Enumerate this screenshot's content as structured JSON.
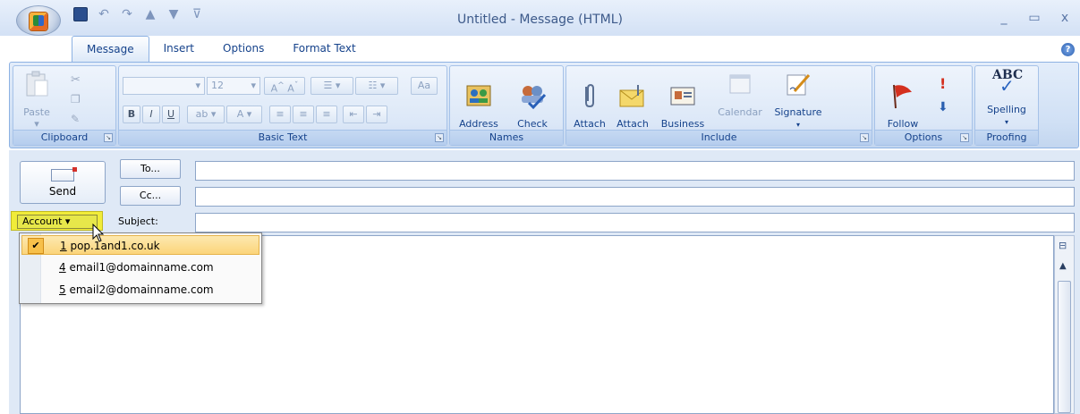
{
  "window": {
    "title": "Untitled - Message (HTML)",
    "minimize": "_",
    "maximize": "▭",
    "close": "x"
  },
  "tabs": [
    "Message",
    "Insert",
    "Options",
    "Format Text"
  ],
  "ribbon": {
    "clipboard": {
      "label": "Clipboard",
      "paste": "Paste"
    },
    "basic_text": {
      "label": "Basic Text",
      "font_size": "12",
      "bold": "B",
      "italic": "I",
      "underline": "U"
    },
    "names": {
      "label": "Names",
      "address_book": "Address\nBook",
      "check_names": "Check\nNames"
    },
    "include": {
      "label": "Include",
      "attach_file": "Attach\nFile",
      "attach_item": "Attach\nItem",
      "business_card": "Business\nCard ▾",
      "calendar": "Calendar",
      "signature": "Signature"
    },
    "options": {
      "label": "Options",
      "follow_up": "Follow\nUp ▾"
    },
    "proofing": {
      "label": "Proofing",
      "spelling": "Spelling",
      "abc": "ABC"
    }
  },
  "compose": {
    "send": "Send",
    "to": "To...",
    "cc": "Cc...",
    "account": "Account ▾",
    "subject": "Subject:"
  },
  "account_menu": [
    {
      "key": "1",
      "rest": " pop.1and1.co.uk",
      "selected": true
    },
    {
      "key": "4",
      "rest": " email1@domainname.com",
      "selected": false
    },
    {
      "key": "5",
      "rest": " email2@domainname.com",
      "selected": false
    }
  ],
  "colors": {
    "ribbon_bg": "#d0e0f5",
    "highlight": "#f1ec39",
    "text": "#15428b"
  }
}
